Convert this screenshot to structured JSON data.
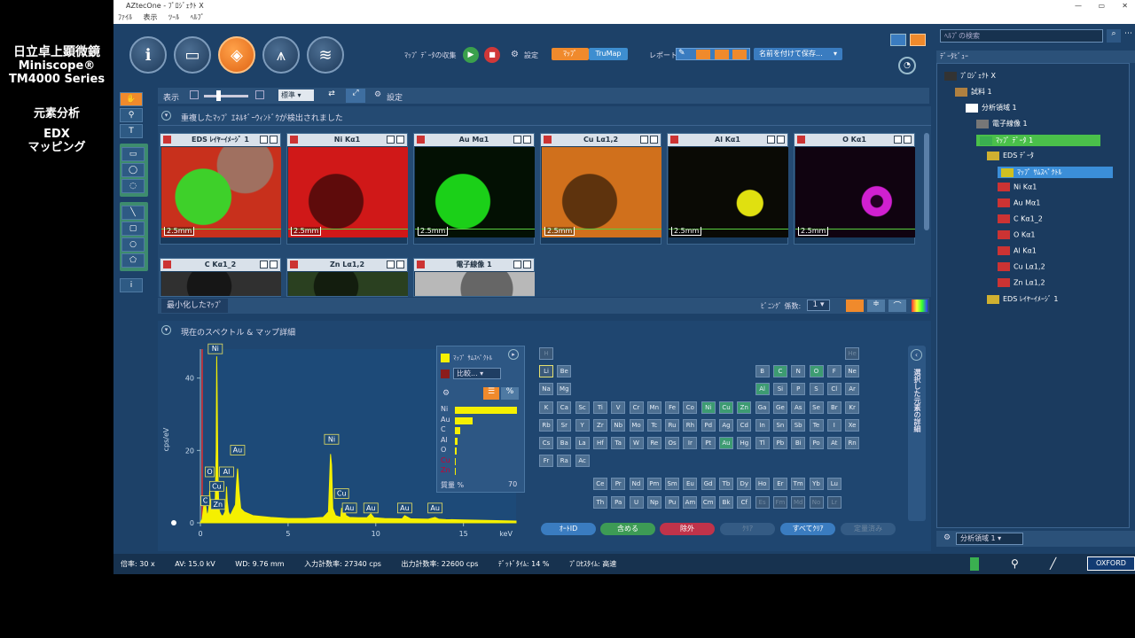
{
  "caption": {
    "line1": "日立卓上顕微鏡",
    "line2": "Miniscope®",
    "line3": "TM4000 Series",
    "line4": "元素分析",
    "line5": "EDX",
    "line6": "マッピング"
  },
  "window": {
    "title": "AZtecOne - ﾌﾟﾛｼﾞｪｸﾄ X"
  },
  "menu": [
    "ﾌｧｲﾙ",
    "表示",
    "ﾂｰﾙ",
    "ﾍﾙﾌﾟ"
  ],
  "toolbar": {
    "collect_label": "ﾏｯﾌﾟ ﾃﾞｰﾀの収集",
    "settings": "設定",
    "map_tab": "ﾏｯﾌﾟ",
    "trumap_tab": "TruMap",
    "report": "レポート",
    "save_as": "名前を付けて保存..."
  },
  "search": {
    "placeholder": "ﾍﾙﾌﾟの検索"
  },
  "viewbar": {
    "display": "表示",
    "standard": "標準",
    "settings": "設定"
  },
  "mapspanel": {
    "header": "重複したﾏｯﾌﾟ ｴﾈﾙｷﾞｰｳｨﾝﾄﾞｳが検出されました"
  },
  "tiles": [
    {
      "title": "EDS ﾚｲﾔｰｲﾒｰｼﾞ 1",
      "scale": "2.5mm",
      "color": "#c8301c"
    },
    {
      "title": "Ni Kα1",
      "scale": "2.5mm",
      "color": "#d01818"
    },
    {
      "title": "Au Mα1",
      "scale": "2.5mm",
      "color": "#1bd018"
    },
    {
      "title": "Cu Lα1,2",
      "scale": "2.5mm",
      "color": "#d0701c"
    },
    {
      "title": "Al Kα1",
      "scale": "2.5mm",
      "color": "#e0e010"
    },
    {
      "title": "O Kα1",
      "scale": "2.5mm",
      "color": "#d020d0"
    },
    {
      "title": "C Kα1_2",
      "scale": "",
      "color": "#303030"
    },
    {
      "title": "Zn Lα1,2",
      "scale": "",
      "color": "#2a4020"
    },
    {
      "title": "電子線像 1",
      "scale": "",
      "color": "#a0a0a0"
    }
  ],
  "minbar": {
    "label": "最小化したﾏｯﾌﾟ",
    "binning": "ﾋﾞﾆﾝｸﾞ 係数:",
    "binning_value": "1"
  },
  "specpanel": {
    "header": "現在のスペクトル & マップ詳細",
    "side_label": "選択した元素の詳細"
  },
  "chart_data": {
    "type": "line",
    "title": "",
    "xlabel": "keV",
    "ylabel": "cps/eV",
    "xlim": [
      0,
      18
    ],
    "ylim": [
      0,
      48
    ],
    "xticks": [
      "0",
      "5",
      "10",
      "15"
    ],
    "yticks": [
      "0",
      "20",
      "40"
    ],
    "x": [
      0.0,
      0.1,
      0.15,
      0.2,
      0.25,
      0.28,
      0.3,
      0.35,
      0.4,
      0.45,
      0.5,
      0.53,
      0.55,
      0.6,
      0.7,
      0.8,
      0.85,
      0.9,
      0.93,
      0.95,
      1.0,
      1.05,
      1.1,
      1.2,
      1.3,
      1.4,
      1.45,
      1.49,
      1.53,
      1.6,
      1.7,
      1.8,
      2.0,
      2.05,
      2.12,
      2.2,
      2.3,
      2.5,
      3.0,
      4.0,
      5.0,
      6.0,
      7.0,
      7.3,
      7.42,
      7.48,
      7.55,
      7.7,
      8.0,
      8.05,
      8.2,
      8.3,
      8.5,
      9.0,
      9.5,
      9.72,
      9.9,
      10.5,
      11.5,
      11.65,
      12.0,
      13.0,
      13.38,
      13.6,
      14.0,
      15.0,
      16.0,
      18.0
    ],
    "y": [
      0,
      1,
      3,
      5,
      3,
      6,
      5,
      3,
      2,
      3,
      5,
      9,
      7,
      5,
      4,
      4,
      7,
      20,
      46,
      38,
      14,
      4,
      3,
      2,
      2,
      3,
      5,
      10,
      6,
      3,
      2,
      3,
      5,
      10,
      15,
      9,
      4,
      3,
      2,
      1.5,
      1.2,
      1.2,
      1.5,
      3,
      19,
      16,
      4,
      2,
      1.5,
      4,
      4,
      2,
      1.5,
      1.4,
      1.4,
      2.5,
      1.4,
      1.2,
      1.1,
      2,
      1.1,
      1,
      1.5,
      1,
      0.9,
      0.8,
      0.7,
      0.5
    ],
    "peak_labels": [
      {
        "label": "Ni",
        "x": 0.85,
        "y": 46
      },
      {
        "label": "Au",
        "x": 2.12,
        "y": 18
      },
      {
        "label": "Al",
        "x": 1.49,
        "y": 12
      },
      {
        "label": "O",
        "x": 0.53,
        "y": 12
      },
      {
        "label": "Cu",
        "x": 0.93,
        "y": 8
      },
      {
        "label": "Zn",
        "x": 1.0,
        "y": 3
      },
      {
        "label": "C",
        "x": 0.28,
        "y": 4
      },
      {
        "label": "Ni",
        "x": 7.48,
        "y": 21
      },
      {
        "label": "Cu",
        "x": 8.05,
        "y": 6
      },
      {
        "label": "Au",
        "x": 8.5,
        "y": 2
      },
      {
        "label": "Au",
        "x": 9.72,
        "y": 2
      },
      {
        "label": "Au",
        "x": 11.65,
        "y": 2
      },
      {
        "label": "Au",
        "x": 13.38,
        "y": 2
      }
    ]
  },
  "legend": {
    "series": "ﾏｯﾌﾟ ｻﾑｽﾍﾟｸﾄﾙ",
    "compare": "比較...",
    "percent": "%",
    "elements": [
      "Ni",
      "Au",
      "C",
      "Al",
      "O",
      "Cu",
      "Zn"
    ],
    "values": [
      63,
      18,
      5,
      3,
      2,
      1,
      1
    ],
    "footer_left": "質量 %",
    "footer_right": "70"
  },
  "periodic": [
    [
      "H",
      "",
      "",
      "",
      "",
      "",
      "",
      "",
      "",
      "",
      "",
      "",
      "",
      "",
      "",
      "",
      "",
      "He"
    ],
    [
      "Li",
      "Be",
      "",
      "",
      "",
      "",
      "",
      "",
      "",
      "",
      "",
      "",
      "B",
      "C",
      "N",
      "O",
      "F",
      "Ne"
    ],
    [
      "Na",
      "Mg",
      "",
      "",
      "",
      "",
      "",
      "",
      "",
      "",
      "",
      "",
      "Al",
      "Si",
      "P",
      "S",
      "Cl",
      "Ar"
    ],
    [
      "K",
      "Ca",
      "Sc",
      "Ti",
      "V",
      "Cr",
      "Mn",
      "Fe",
      "Co",
      "Ni",
      "Cu",
      "Zn",
      "Ga",
      "Ge",
      "As",
      "Se",
      "Br",
      "Kr"
    ],
    [
      "Rb",
      "Sr",
      "Y",
      "Zr",
      "Nb",
      "Mo",
      "Tc",
      "Ru",
      "Rh",
      "Pd",
      "Ag",
      "Cd",
      "In",
      "Sn",
      "Sb",
      "Te",
      "I",
      "Xe"
    ],
    [
      "Cs",
      "Ba",
      "La",
      "Hf",
      "Ta",
      "W",
      "Re",
      "Os",
      "Ir",
      "Pt",
      "Au",
      "Hg",
      "Tl",
      "Pb",
      "Bi",
      "Po",
      "At",
      "Rn"
    ],
    [
      "Fr",
      "Ra",
      "Ac",
      "",
      "",
      "",
      "",
      "",
      "",
      "",
      "",
      "",
      "",
      "",
      "",
      "",
      "",
      ""
    ]
  ],
  "lanthanides": [
    "Ce",
    "Pr",
    "Nd",
    "Pm",
    "Sm",
    "Eu",
    "Gd",
    "Tb",
    "Dy",
    "Ho",
    "Er",
    "Tm",
    "Yb",
    "Lu"
  ],
  "actinides": [
    "Th",
    "Pa",
    "U",
    "Np",
    "Pu",
    "Am",
    "Cm",
    "Bk",
    "Cf",
    "Es",
    "Fm",
    "Md",
    "No",
    "Lr"
  ],
  "selected_elements": [
    "C",
    "O",
    "Al",
    "Ni",
    "Cu",
    "Zn",
    "Au"
  ],
  "bottom_buttons": {
    "autoid": "ｵｰﾄID",
    "include": "含める",
    "exclude": "除外",
    "clear": "ｸﾘｱ",
    "clear_all": "すべてｸﾘｱ",
    "confirmed": "定量済み"
  },
  "status": {
    "mag": "倍率: 30 x",
    "av": "AV: 15.0 kV",
    "wd": "WD: 9.76 mm",
    "input": "入力計数率: 27340 cps",
    "output": "出力計数率: 22600 cps",
    "dead": "ﾃﾞｯﾄﾞﾀｲﾑ: 14 %",
    "process": "ﾌﾟﾛｾｽﾀｲﾑ: 高速"
  },
  "tree": {
    "tab": "ﾃﾞｰﾀﾋﾞｭｰ",
    "items": [
      "ﾌﾟﾛｼﾞｪｸﾄ X",
      "試料 1",
      "分析領域 1",
      "電子線像 1",
      "ﾏｯﾌﾟ ﾃﾞｰﾀ 1",
      "EDS ﾃﾞｰﾀ",
      "ﾏｯﾌﾟ ｻﾑｽﾍﾟｸﾄﾙ",
      "Ni Kα1",
      "Au Mα1",
      "C Kα1_2",
      "O Kα1",
      "Al Kα1",
      "Cu Lα1,2",
      "Zn Lα1,2",
      "EDS ﾚｲﾔｰｲﾒｰｼﾞ 1"
    ],
    "footer": "分析領域 1"
  },
  "oxford": "OXFORD"
}
